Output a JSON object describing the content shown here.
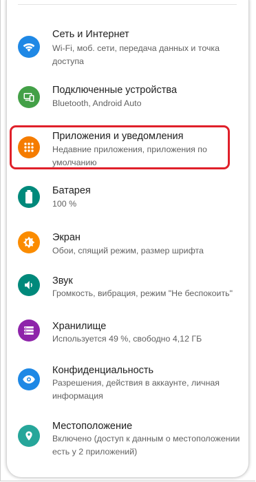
{
  "settings": {
    "items": [
      {
        "icon": "wifi-icon",
        "color": "#1f88e5",
        "title": "Сеть и Интернет",
        "subtitle": "Wi-Fi, моб. сети, передача данных и точка доступа"
      },
      {
        "icon": "connected-devices-icon",
        "color": "#43a047",
        "title": "Подключенные устройства",
        "subtitle": "Bluetooth, Android Auto"
      },
      {
        "icon": "apps-grid-icon",
        "color": "#f57c00",
        "title": "Приложения и уведомления",
        "subtitle": "Недавние приложения, приложения по умолчанию",
        "highlighted": true
      },
      {
        "icon": "battery-icon",
        "color": "#00897b",
        "title": "Батарея",
        "subtitle": "100 %"
      },
      {
        "icon": "brightness-icon",
        "color": "#fb8c00",
        "title": "Экран",
        "subtitle": "Обои, спящий режим, размер шрифта"
      },
      {
        "icon": "volume-icon",
        "color": "#00897b",
        "title": "Звук",
        "subtitle": "Громкость, вибрация, режим \"Не беспокоить\""
      },
      {
        "icon": "storage-icon",
        "color": "#8e24aa",
        "title": "Хранилище",
        "subtitle": "Используется 49 %, свободно 4,12 ГБ"
      },
      {
        "icon": "privacy-eye-icon",
        "color": "#1e88e5",
        "title": "Конфиденциальность",
        "subtitle": "Разрешения, действия в аккаунте, личная информация"
      },
      {
        "icon": "location-pin-icon",
        "color": "#26a69a",
        "title": "Местоположение",
        "subtitle": "Включено (доступ к данным о местоположении есть у 2 приложений)"
      }
    ]
  }
}
